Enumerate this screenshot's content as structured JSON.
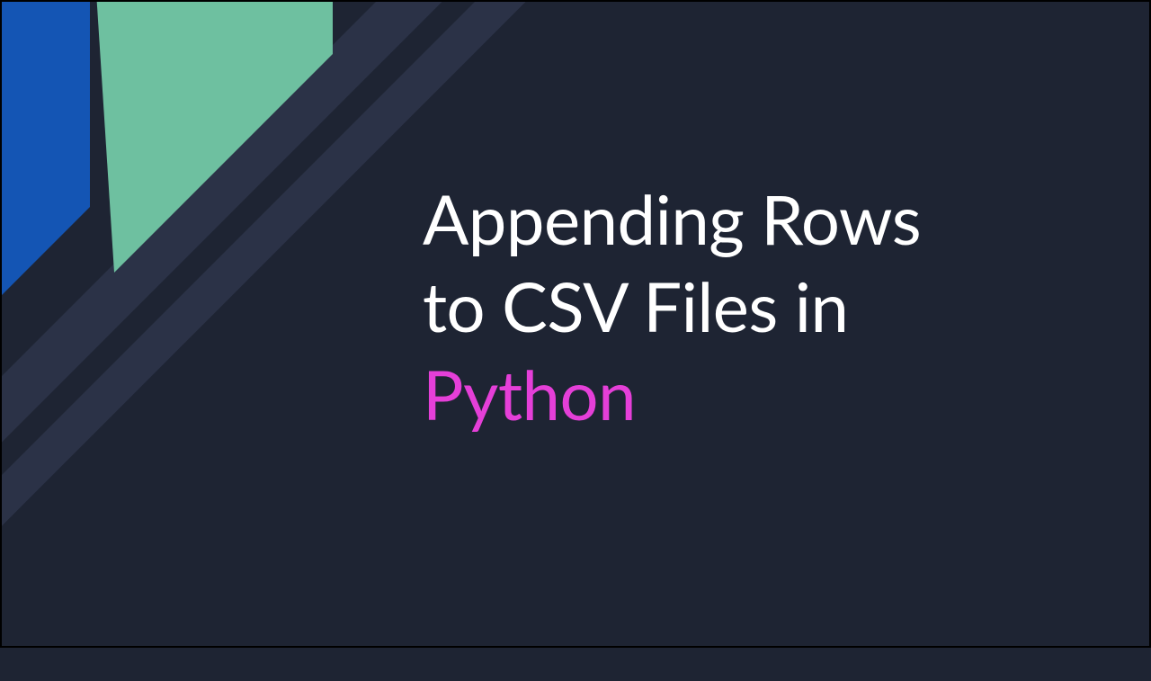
{
  "slide": {
    "title_line1": "Appending Rows",
    "title_line2": "to CSV Files in",
    "title_highlight": "Python"
  },
  "colors": {
    "background": "#1e2433",
    "stripe": "#2b3247",
    "blue_shape": "#1455b4",
    "green_shape": "#6ec0a0",
    "text": "#ffffff",
    "highlight": "#e53fd8"
  }
}
